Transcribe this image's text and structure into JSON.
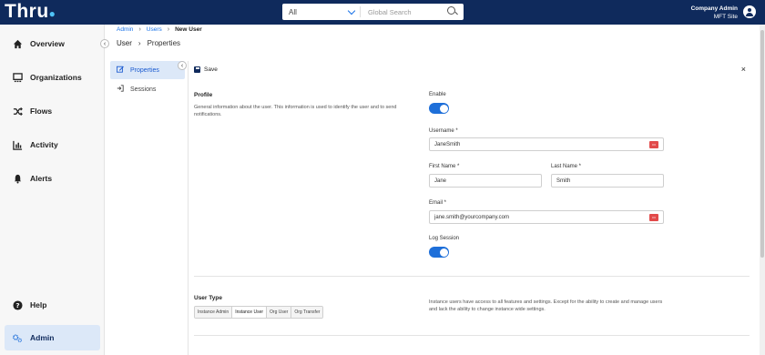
{
  "header": {
    "logo": "Thru",
    "logo_dot": "●",
    "search_scope": "All",
    "search_placeholder": "Global Search",
    "user_role": "Company Admin",
    "user_site": "MFT Site"
  },
  "nav": {
    "items": [
      {
        "label": "Overview",
        "icon": "home-icon"
      },
      {
        "label": "Organizations",
        "icon": "organizations-icon"
      },
      {
        "label": "Flows",
        "icon": "shuffle-icon"
      },
      {
        "label": "Activity",
        "icon": "chart-icon"
      },
      {
        "label": "Alerts",
        "icon": "bell-icon"
      },
      {
        "label": "Help",
        "icon": "help-icon"
      },
      {
        "label": "Admin",
        "icon": "gears-icon"
      }
    ],
    "active": "Admin"
  },
  "breadcrumb": {
    "items": [
      "Admin",
      "Users",
      "New User"
    ],
    "separator": "›"
  },
  "page": {
    "title": "User",
    "subtitle": "Properties",
    "separator": "›"
  },
  "subnav": {
    "items": [
      {
        "label": "Properties",
        "icon": "edit-icon"
      },
      {
        "label": "Sessions",
        "icon": "sign-in-icon"
      }
    ]
  },
  "toolbar": {
    "save_label": "Save",
    "close_label": "×"
  },
  "profile": {
    "title": "Profile",
    "description": "General information about the user. This information is used to identify the user and to send notifications.",
    "enable_label": "Enable",
    "enable_value": true,
    "username_label": "Username *",
    "username_value": "JaneSmith",
    "first_name_label": "First Name *",
    "first_name_value": "Jane",
    "last_name_label": "Last Name *",
    "last_name_value": "Smith",
    "email_label": "Email *",
    "email_value": "jane.smith@yourcompany.com",
    "log_session_label": "Log Session",
    "log_session_value": true,
    "key_badge_text": "•••"
  },
  "user_type": {
    "title": "User Type",
    "options": [
      "Instance Admin",
      "Instance User",
      "Org User",
      "Org Transfer"
    ],
    "selected": "Instance User",
    "description": "Instance users have access to all features and settings. Except for the ability to create and manage users and lack the ability to change instance wide settings."
  },
  "colors": {
    "topbar": "#0f2a5c",
    "accent": "#1e6fd9",
    "active_bg": "#dce8f8"
  }
}
